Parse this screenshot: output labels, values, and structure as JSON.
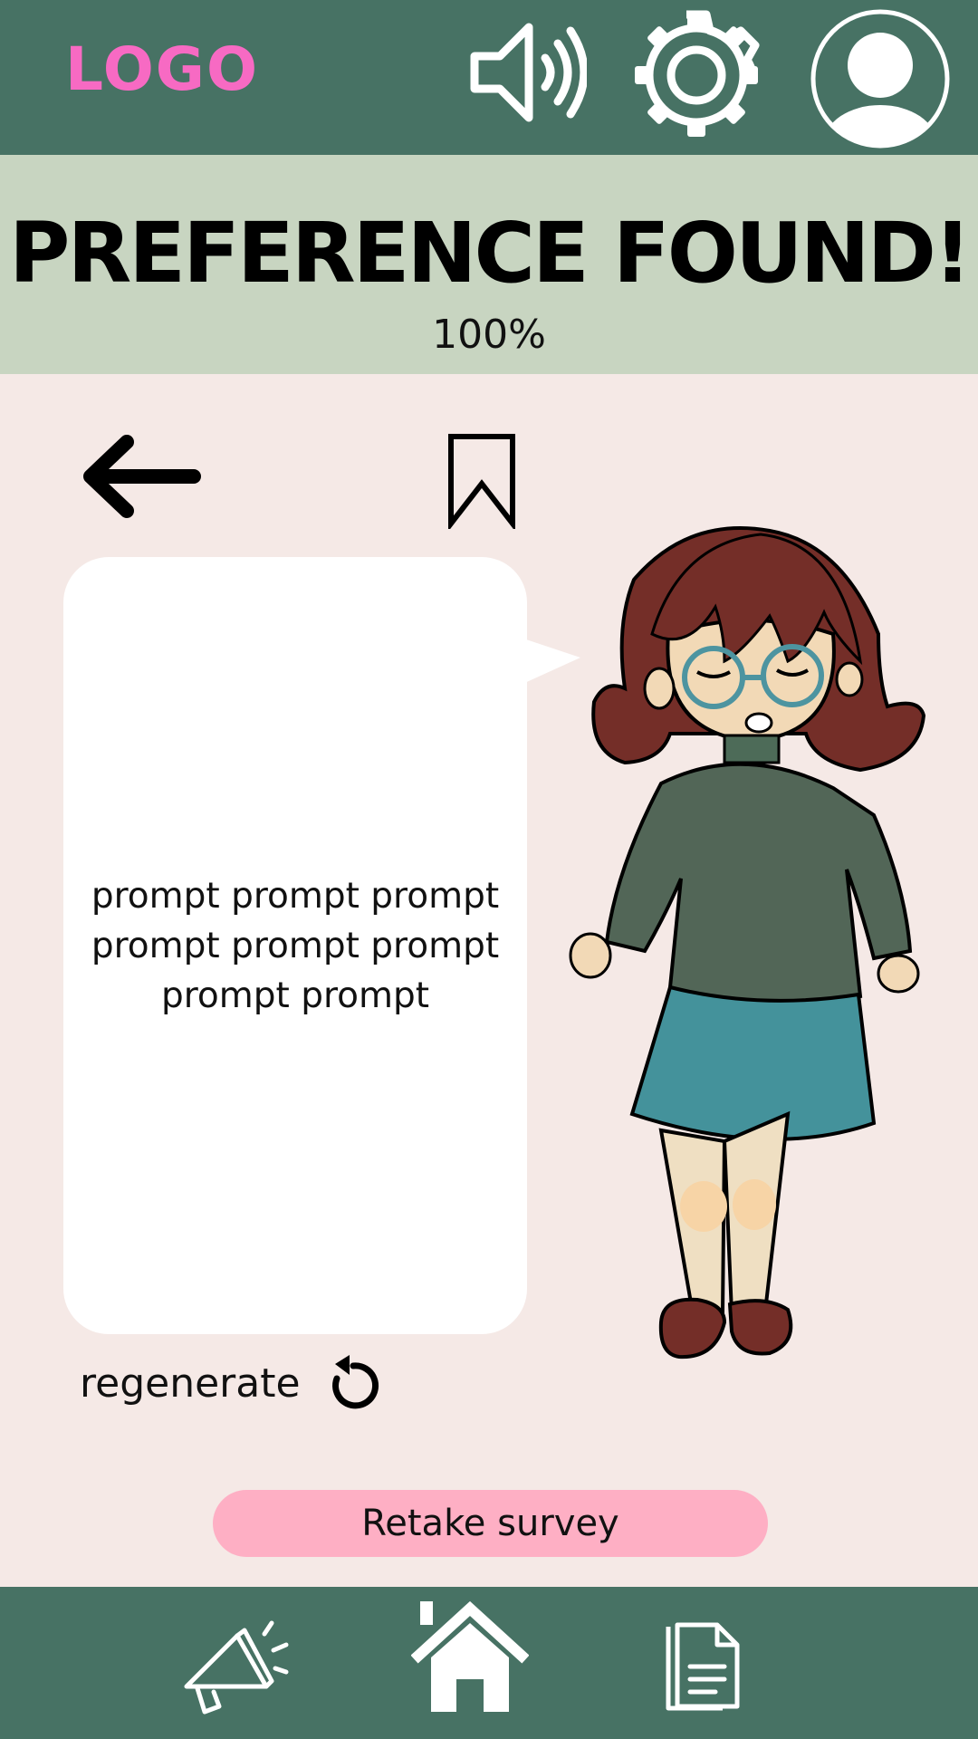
{
  "header": {
    "logo_text": "LOGO",
    "icons": [
      "speaker-icon",
      "gear-icon",
      "user-avatar-icon"
    ]
  },
  "banner": {
    "title": "PREFERENCE FOUND!",
    "progress_label": "100%",
    "progress": 1.0
  },
  "toolbar": {
    "icons": [
      "back-arrow-icon",
      "bookmark-icon"
    ]
  },
  "bubble": {
    "prompt_text": "prompt prompt prompt prompt prompt prompt prompt prompt"
  },
  "regenerate": {
    "label": "regenerate",
    "icon": "refresh-icon"
  },
  "retake": {
    "label": "Retake survey"
  },
  "bottom_nav": {
    "icons": [
      "megaphone-icon",
      "home-icon",
      "document-icon"
    ]
  },
  "colors": {
    "bar": "#477264",
    "banner": "#c8d5c1",
    "background": "#f5e9e6",
    "logo": "#f76ac3",
    "retake_button": "#feafc4"
  }
}
